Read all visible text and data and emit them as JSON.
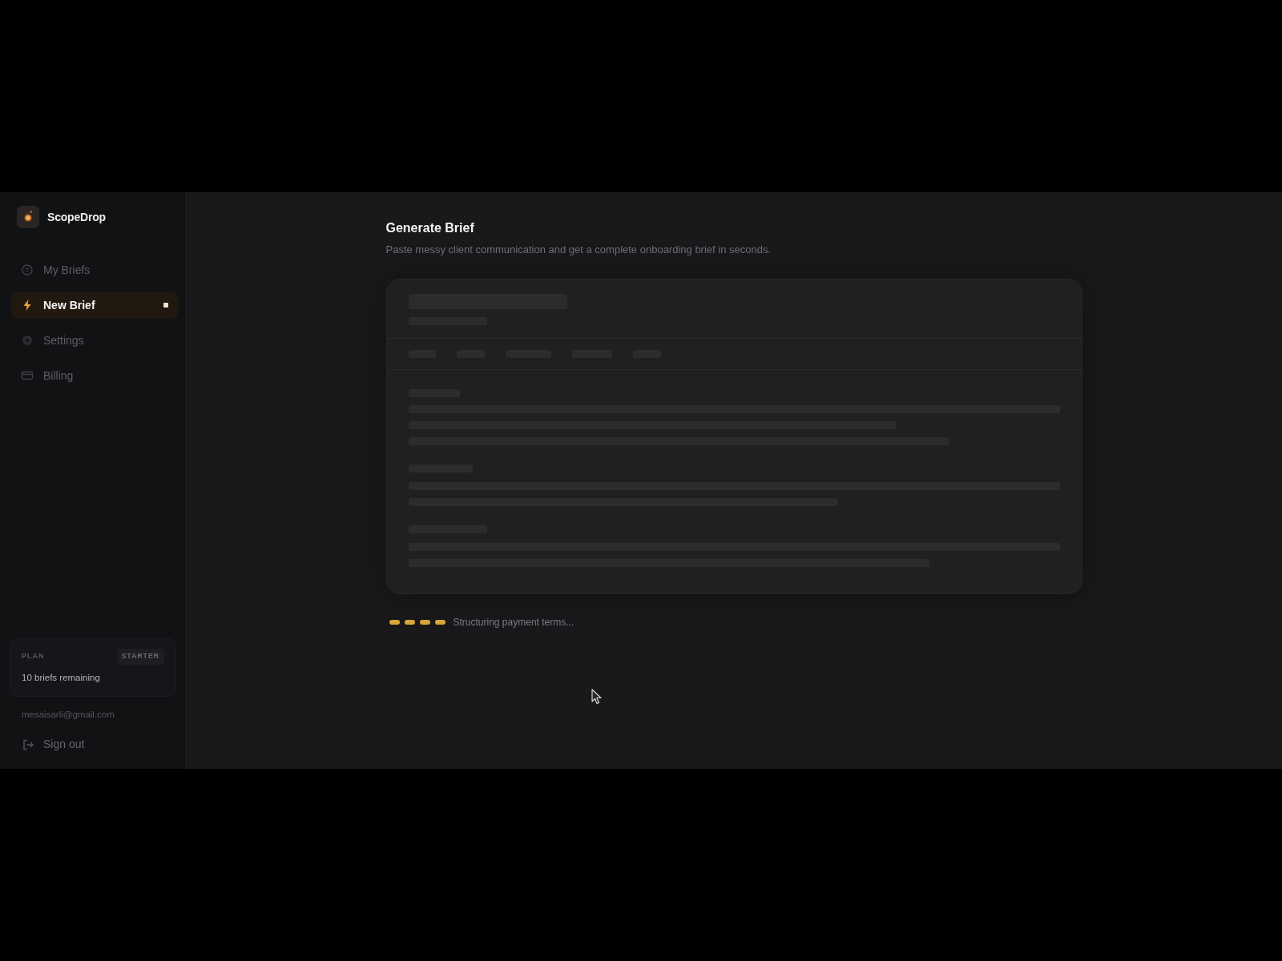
{
  "sidebar": {
    "logo": {
      "text": "ScopeDrop"
    },
    "items": [
      {
        "label": "My Briefs",
        "selected": false
      },
      {
        "label": "New Brief",
        "selected": true
      },
      {
        "label": "Settings",
        "selected": false
      },
      {
        "label": "Billing",
        "selected": false
      }
    ],
    "plan": {
      "label": "PLAN",
      "badge": "STARTER",
      "remaining": "10 briefs remaining"
    },
    "email": "mesaisarli@gmail.com",
    "sign_out": "Sign out"
  },
  "main": {
    "title": "Generate Brief",
    "subtitle": "Paste messy client communication and get a complete onboarding brief in seconds.",
    "status": "Structuring payment terms..."
  }
}
